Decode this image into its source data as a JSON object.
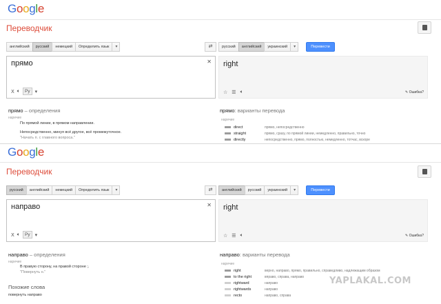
{
  "logo": {
    "letters": [
      "G",
      "o",
      "o",
      "g",
      "l",
      "e"
    ]
  },
  "top": {
    "title": "Переводчик",
    "src_langs": [
      "английский",
      "русский",
      "немецкий",
      "Определить язык"
    ],
    "src_active": 1,
    "tgt_langs": [
      "русский",
      "английский",
      "украинский"
    ],
    "tgt_active": 1,
    "translate_label": "Перевести",
    "source_text": "прямо",
    "ru_label": "Ру",
    "output_text": "right",
    "error_label": "Ошибка?",
    "def_word": "прямо",
    "def_tail": "– определения",
    "def_pos": "наречие",
    "def_lines": [
      "По прямой линии, в прямом направлении.",
      "Непосредственно, минуя всё другое, всё промежуточное.",
      "\"Начать п. с главного вопроса.\""
    ],
    "var_word": "прямо",
    "var_tail": ": варианты перевода",
    "var_pos": "наречие",
    "variants": [
      {
        "word": "direct",
        "syn": "прямо, непосредственно"
      },
      {
        "word": "straight",
        "syn": "прямо, сразу, по прямой линии, немедленно, правильно, точно"
      },
      {
        "word": "directly",
        "syn": "непосредственно, прямо, полностью, немедленно, тотчас, вскоре"
      }
    ]
  },
  "bottom": {
    "title": "Переводчик",
    "src_langs": [
      "русский",
      "английский",
      "немецкий",
      "Определить язык"
    ],
    "src_active": 0,
    "tgt_langs": [
      "английский",
      "русский",
      "украинский"
    ],
    "tgt_active": 0,
    "translate_label": "Перевести",
    "source_text": "направо",
    "ru_label": "Ру",
    "output_text": "right",
    "error_label": "Ошибка?",
    "def_word": "направо",
    "def_tail": "– определения",
    "def_pos": "наречие",
    "def_lines": [
      "В правую сторону, на правой стороне ;.",
      "\"Повернуть н.\""
    ],
    "similar_title": "Похожие слова",
    "similar_item": "повернуть направо",
    "var_word": "направо",
    "var_tail": ": варианты перевода",
    "var_pos": "наречие",
    "variants": [
      {
        "word": "right",
        "syn": "верно, направо, прямо, правильно, справедливо, надлежащим образом"
      },
      {
        "word": "to the right",
        "syn": "вправо, справа, направо"
      },
      {
        "word": "rightward",
        "syn": "направо"
      },
      {
        "word": "rightwards",
        "syn": "направо"
      },
      {
        "word": "recto",
        "syn": "направо, справа"
      }
    ]
  },
  "watermark": "YAPLAKAL.COM",
  "colors": {
    "title_red": "#dd4b39",
    "button_blue": "#4d90fe"
  }
}
